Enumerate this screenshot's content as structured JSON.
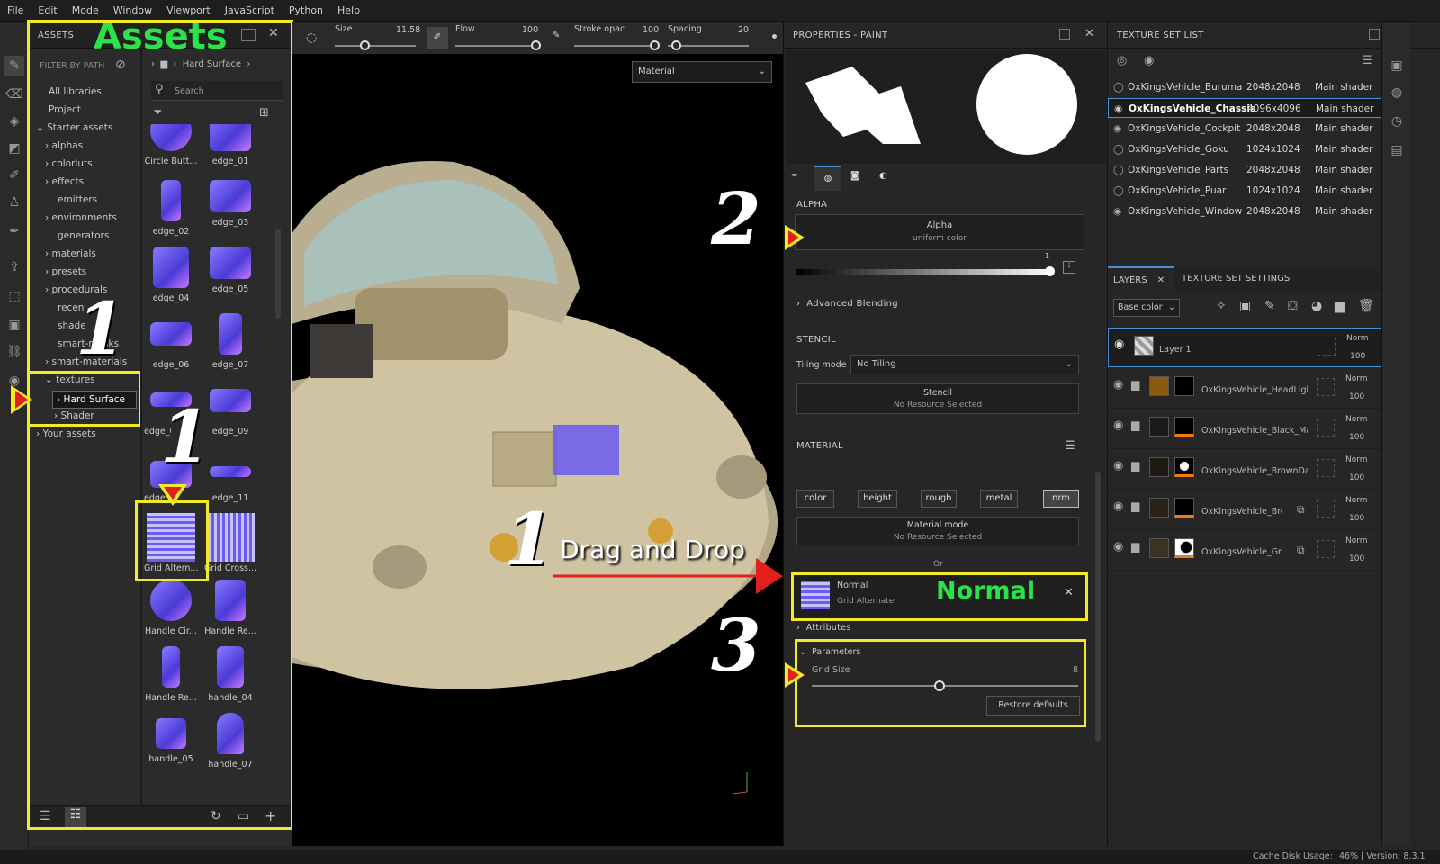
{
  "menu": [
    "File",
    "Edit",
    "Mode",
    "Window",
    "Viewport",
    "JavaScript",
    "Python",
    "Help"
  ],
  "assets": {
    "title": "ASSETS",
    "overlay_title": "Assets",
    "filter_label": "FILTER BY PATH",
    "breadcrumb": "Hard Surface",
    "search_placeholder": "Search",
    "tree": [
      "All libraries",
      "Project",
      "Starter assets",
      "alphas",
      "colorluts",
      "effects",
      "emitters",
      "environments",
      "generators",
      "materials",
      "presets",
      "procedurals",
      "recent",
      "shaders",
      "smart-masks",
      "smart-materials",
      "textures",
      "Hard Surface",
      "Shader",
      "Your assets"
    ],
    "thumbs": [
      "Circle Butt...",
      "edge_01",
      "edge_02",
      "edge_03",
      "edge_04",
      "edge_05",
      "edge_06",
      "edge_07",
      "edge_08",
      "edge_09",
      "edge_10",
      "edge_11",
      "Grid Altern...",
      "Grid Cross...",
      "Handle Cir...",
      "Handle Re...",
      "Handle Re...",
      "handle_04",
      "handle_05",
      "handle_07"
    ]
  },
  "toolbar": {
    "size_label": "Size",
    "size_value": "11.58",
    "flow_label": "Flow",
    "flow_value": "100",
    "stroke_label": "Stroke opac",
    "stroke_value": "100",
    "spacing_label": "Spacing",
    "spacing_value": "20",
    "material_select": "Material"
  },
  "viewport": {
    "drag_text": "Drag and Drop"
  },
  "annotations": {
    "n1": "1",
    "n2": "2",
    "n3": "3",
    "normal": "Normal"
  },
  "properties": {
    "title": "PROPERTIES - PAINT",
    "alpha_section": "ALPHA",
    "alpha_title": "Alpha",
    "alpha_sub": "uniform color",
    "alpha_value": "1",
    "advanced_blending": "Advanced Blending",
    "stencil_section": "STENCIL",
    "tiling_label": "Tiling mode",
    "tiling_value": "No Tiling",
    "stencil_title": "Stencil",
    "stencil_sub": "No Resource Selected",
    "material_section": "MATERIAL",
    "channels": [
      "color",
      "height",
      "rough",
      "metal",
      "nrm"
    ],
    "material_mode": "Material mode",
    "material_mode_sub": "No Resource Selected",
    "or": "Or",
    "normal_title": "Normal",
    "normal_sub": "Grid Alternate",
    "attributes": "Attributes",
    "parameters": "Parameters",
    "grid_size_label": "Grid Size",
    "grid_size_value": "8",
    "restore": "Restore defaults"
  },
  "texture_set_list": {
    "title": "TEXTURE SET LIST",
    "rows": [
      {
        "name": "OxKingsVehicle_Buruma",
        "res": "2048x2048",
        "shader": "Main shader"
      },
      {
        "name": "OxKingsVehicle_Chassis",
        "res": "4096x4096",
        "shader": "Main shader"
      },
      {
        "name": "OxKingsVehicle_Cockpit",
        "res": "2048x2048",
        "shader": "Main shader"
      },
      {
        "name": "OxKingsVehicle_Goku",
        "res": "1024x1024",
        "shader": "Main shader"
      },
      {
        "name": "OxKingsVehicle_Parts",
        "res": "2048x2048",
        "shader": "Main shader"
      },
      {
        "name": "OxKingsVehicle_Puar",
        "res": "1024x1024",
        "shader": "Main shader"
      },
      {
        "name": "OxKingsVehicle_Window",
        "res": "2048x2048",
        "shader": "Main shader"
      }
    ]
  },
  "layers": {
    "tab_layers": "LAYERS",
    "tab_settings": "TEXTURE SET SETTINGS",
    "channel_select": "Base color",
    "rows": [
      {
        "name": "Layer 1",
        "blend": "Norm",
        "opacity": "100"
      },
      {
        "name": "OxKingsVehicle_HeadLigh···",
        "blend": "Norm",
        "opacity": "100"
      },
      {
        "name": "OxKingsVehicle_Black_Ma···",
        "blend": "Norm",
        "opacity": "100"
      },
      {
        "name": "OxKingsVehicle_BrownDa···",
        "blend": "Norm",
        "opacity": "100"
      },
      {
        "name": "OxKingsVehicle_Bro···",
        "blend": "Norm",
        "opacity": "100"
      },
      {
        "name": "OxKingsVehicle_Gre···",
        "blend": "Norm",
        "opacity": "100"
      }
    ]
  },
  "status": {
    "cache": "Cache Disk Usage:",
    "cache_value": "46%",
    "version": "| Version: 8.3.1"
  },
  "colors": {
    "highlight": "#f2ea27",
    "green": "#2be24a",
    "arrow_red": "#e0201a"
  }
}
